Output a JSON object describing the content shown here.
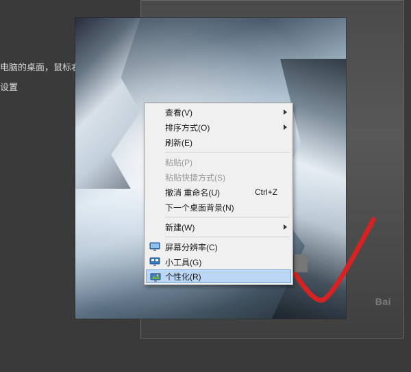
{
  "page": {
    "line1": "电脑的桌面，鼠标右",
    "line2": "设置"
  },
  "watermark": "Bai",
  "menu": {
    "view": {
      "label": "查看(V)"
    },
    "sort": {
      "label": "排序方式(O)"
    },
    "refresh": {
      "label": "刷新(E)"
    },
    "paste": {
      "label": "粘贴(P)"
    },
    "paste_shortcut": {
      "label": "粘贴快捷方式(S)"
    },
    "undo": {
      "label": "撤消 重命名(U)",
      "shortcut": "Ctrl+Z"
    },
    "next_bg": {
      "label": "下一个桌面背景(N)"
    },
    "new": {
      "label": "新建(W)"
    },
    "resolution": {
      "label": "屏幕分辨率(C)"
    },
    "gadgets": {
      "label": "小工具(G)"
    },
    "personalize": {
      "label": "个性化(R)"
    }
  }
}
